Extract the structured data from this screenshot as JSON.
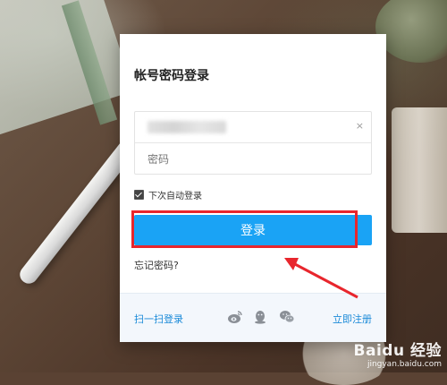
{
  "login": {
    "title": "帐号密码登录",
    "account_clear_icon": "×",
    "password_placeholder": "密码",
    "remember_label": "下次自动登录",
    "remember_checked": true,
    "submit_label": "登录",
    "forgot_label": "忘记密码?"
  },
  "footer": {
    "scan_label": "扫一扫登录",
    "social_icons": [
      "weibo-icon",
      "qq-icon",
      "wechat-icon"
    ],
    "register_label": "立即注册"
  },
  "colors": {
    "primary": "#1aa3f5",
    "link": "#1a8ad8",
    "annotation": "#e8262d",
    "footer_bg": "#f3f7fc"
  },
  "watermark": {
    "brand": "Baidu 经验",
    "url": "jingyan.baidu.com"
  }
}
